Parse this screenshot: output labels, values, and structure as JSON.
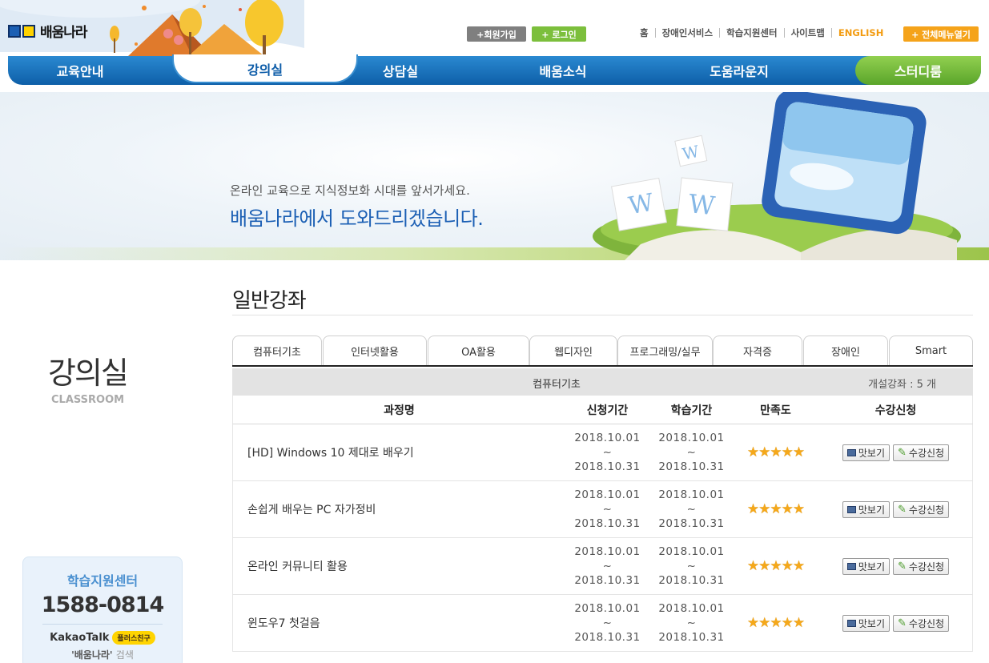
{
  "site": {
    "logo_text": "배움나라"
  },
  "header": {
    "join_label": "+회원가입",
    "login_label": "+ 로그인",
    "util_links": [
      "홈",
      "장애인서비스",
      "학습지원센터",
      "사이트맵"
    ],
    "english_label": "ENGLISH",
    "full_menu_label": "+ 전체메뉴열기"
  },
  "gnb": {
    "items": [
      "교육안내",
      "강의실",
      "상담실",
      "배움소식",
      "도움라운지",
      "스터디룸"
    ],
    "active": "강의실"
  },
  "banner": {
    "sub": "온라인 교육으로 지식정보화 시대를 앞서가세요.",
    "main": "배움나라에서 도와드리겠습니다."
  },
  "side": {
    "title": "강의실",
    "subtitle": "CLASSROOM",
    "support": {
      "title": "학습지원센터",
      "phone": "1588-0814",
      "kakao": "KakaoTalk",
      "plus_friend": "플러스친구",
      "search_term": "'배움나라'",
      "search_label": "검색"
    }
  },
  "content": {
    "title": "일반강좌",
    "tabs": [
      "컴퓨터기초",
      "인터넷활용",
      "OA활용",
      "웹디자인",
      "프로그래밍/실무",
      "자격증",
      "장애인",
      "Smart"
    ],
    "category": "컴퓨터기초",
    "count_text": "개설강좌 : 5 개",
    "columns": [
      "과정명",
      "신청기간",
      "학습기간",
      "만족도",
      "수강신청"
    ],
    "preview_label": "맛보기",
    "enroll_label": "수강신청",
    "rows": [
      {
        "name": "[HD] Windows 10 제대로 배우기",
        "apply_start": "2018.10.01",
        "apply_end": "2018.10.31",
        "study_start": "2018.10.01",
        "study_end": "2018.10.31",
        "rating": "★★★★★"
      },
      {
        "name": "손쉽게 배우는 PC 자가정비",
        "apply_start": "2018.10.01",
        "apply_end": "2018.10.31",
        "study_start": "2018.10.01",
        "study_end": "2018.10.31",
        "rating": "★★★★★"
      },
      {
        "name": "온라인 커뮤니티 활용",
        "apply_start": "2018.10.01",
        "apply_end": "2018.10.31",
        "study_start": "2018.10.01",
        "study_end": "2018.10.31",
        "rating": "★★★★★"
      },
      {
        "name": "윈도우7 첫걸음",
        "apply_start": "2018.10.01",
        "apply_end": "2018.10.31",
        "study_start": "2018.10.01",
        "study_end": "2018.10.31",
        "rating": "★★★★★"
      }
    ],
    "date_separator": "~"
  }
}
